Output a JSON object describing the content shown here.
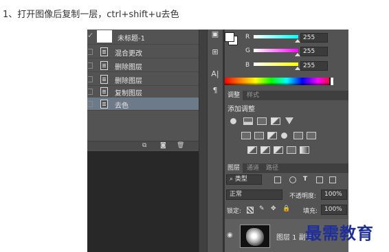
{
  "instruction": "1、打开图像后复制一层，ctrl+shift+u去色",
  "history": {
    "snapshot_label": "未标题-1",
    "items": [
      {
        "label": "混合更改",
        "selected": false
      },
      {
        "label": "删除图层",
        "selected": false
      },
      {
        "label": "删除图层",
        "selected": false
      },
      {
        "label": "复制图层",
        "selected": false
      },
      {
        "label": "去色",
        "selected": true
      }
    ]
  },
  "color": {
    "channels": [
      {
        "label": "R",
        "value": "255",
        "color": "#00ffff"
      },
      {
        "label": "G",
        "value": "255",
        "color": "#ff00ff"
      },
      {
        "label": "B",
        "value": "255",
        "color": "#ffff00"
      }
    ]
  },
  "adjustments": {
    "tabs": [
      "调整",
      "样式"
    ],
    "title": "添加调整"
  },
  "layers": {
    "tabs": [
      "图层",
      "通道",
      "路径"
    ],
    "filter_kind": "类型",
    "blend_mode": "正常",
    "opacity_label": "不透明度:",
    "opacity_value": "100%",
    "lock_label": "锁定:",
    "fill_label": "填充:",
    "fill_value": "100%",
    "layer_name": "图层 1 副本"
  },
  "tool_glyphs": [
    "A|",
    "¶"
  ],
  "watermark": "最需教育"
}
